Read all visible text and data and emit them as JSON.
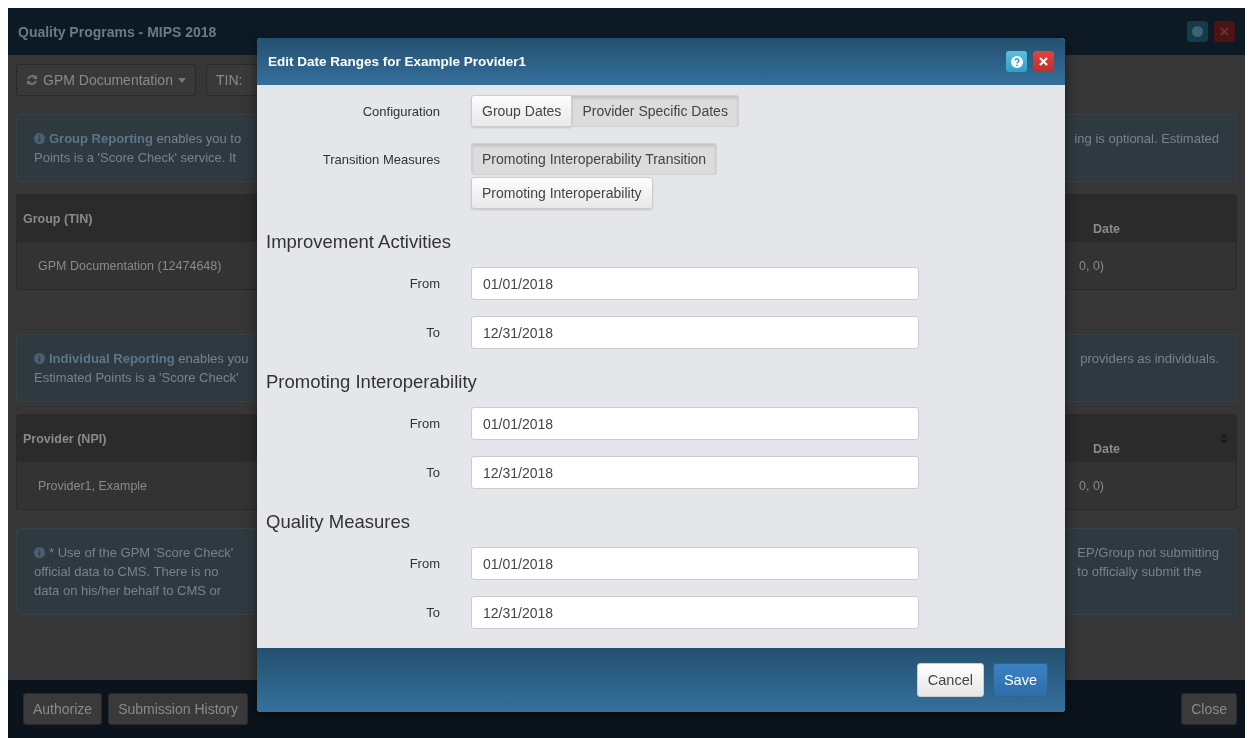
{
  "app": {
    "title": "Quality Programs - MIPS 2018",
    "toolbar": {
      "group_dropdown": "GPM Documentation",
      "tin_label": "TIN:"
    },
    "group_info": {
      "left_lines": [
        "**Group Reporting** enables you to",
        "Points is a 'Score Check' service. It"
      ],
      "right_lines": [
        "ing is optional. Estimated"
      ]
    },
    "group_table": {
      "header_left": "Group (TIN)",
      "header_right": "Date",
      "row_left": "GPM Documentation (12474648)",
      "row_right": "0, 0)"
    },
    "individual_info": {
      "left_lines": [
        "**Individual Reporting** enables you",
        "Estimated Points is a 'Score Check'"
      ],
      "right_lines": [
        "providers as individuals."
      ]
    },
    "provider_table": {
      "header_left": "Provider (NPI)",
      "header_right": "Date",
      "row_left": "Provider1, Example",
      "row_right": "0, 0)"
    },
    "note_info": {
      "left_lines": [
        "* Use of the GPM 'Score Check'",
        "official data to CMS. There is no",
        "data on his/her behalf to CMS or"
      ],
      "right_lines": [
        "EP/Group not submitting",
        "to officially submit the"
      ]
    },
    "footer_buttons": [
      {
        "label": "Authorize"
      },
      {
        "label": "Submission History"
      },
      {
        "label": "Close"
      }
    ]
  },
  "dialog": {
    "title": "Edit Date Ranges for Example Provider1",
    "configuration": {
      "label": "Configuration",
      "options": [
        {
          "label": "Group Dates",
          "selected": false
        },
        {
          "label": "Provider Specific Dates",
          "selected": true
        }
      ]
    },
    "transition_measures": {
      "label": "Transition Measures",
      "options": [
        {
          "label": "Promoting Interoperability Transition",
          "selected": true
        },
        {
          "label": "Promoting Interoperability",
          "selected": false
        }
      ]
    },
    "sections": [
      {
        "heading": "Improvement Activities",
        "fields": [
          {
            "label": "From",
            "value": "01/01/2018"
          },
          {
            "label": "To",
            "value": "12/31/2018"
          }
        ]
      },
      {
        "heading": "Promoting Interoperability",
        "fields": [
          {
            "label": "From",
            "value": "01/01/2018"
          },
          {
            "label": "To",
            "value": "12/31/2018"
          }
        ]
      },
      {
        "heading": "Quality Measures",
        "fields": [
          {
            "label": "From",
            "value": "01/01/2018"
          },
          {
            "label": "To",
            "value": "12/31/2018"
          }
        ]
      }
    ],
    "buttons": [
      {
        "label": "Cancel",
        "kind": "default"
      },
      {
        "label": "Save",
        "kind": "primary"
      }
    ]
  }
}
